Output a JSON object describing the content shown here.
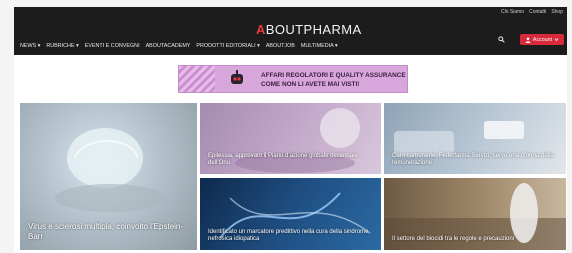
{
  "top_links": [
    "Chi Siamo",
    "Contatti",
    "Shop"
  ],
  "logo": {
    "mark": "A",
    "text": "BOUTPHARMA"
  },
  "nav": [
    "NEWS ▾",
    "RUBRICHE ▾",
    "EVENTI E CONVEGNI",
    "ABOUTACADEMY",
    "PRODOTTI EDITORIALI ▾",
    "ABOUTJOB",
    "MULTIMEDIA ▾"
  ],
  "account_label": "Account",
  "banner": {
    "line1": "AFFARI REGOLATORI E QUALITY ASSURANCE",
    "line2": "COME NON LI AVETE MAI VISTI!"
  },
  "articles": [
    {
      "title": "Virus e sclerosi multipla, coinvolto l’Epstein-Barr"
    },
    {
      "title": "Epilessia, approvato il Piano d’azione globale decennale dell’Onu"
    },
    {
      "title": "Caro carburante, Federfarma Servizi: serve una riforma della remunerazione"
    },
    {
      "title": "Identificato un marcatore predittivo nella cura della sindrome nefrosica idiopatica"
    },
    {
      "title": "Il settore del biocidi tra le regole e precauzioni"
    }
  ],
  "colors": {
    "header": "#1c1c1c",
    "accent": "#d92a3c",
    "banner": "#d7a6da"
  },
  "icons": {
    "search": "search-icon",
    "user": "user-icon",
    "chevron": "chevron-down-icon"
  }
}
